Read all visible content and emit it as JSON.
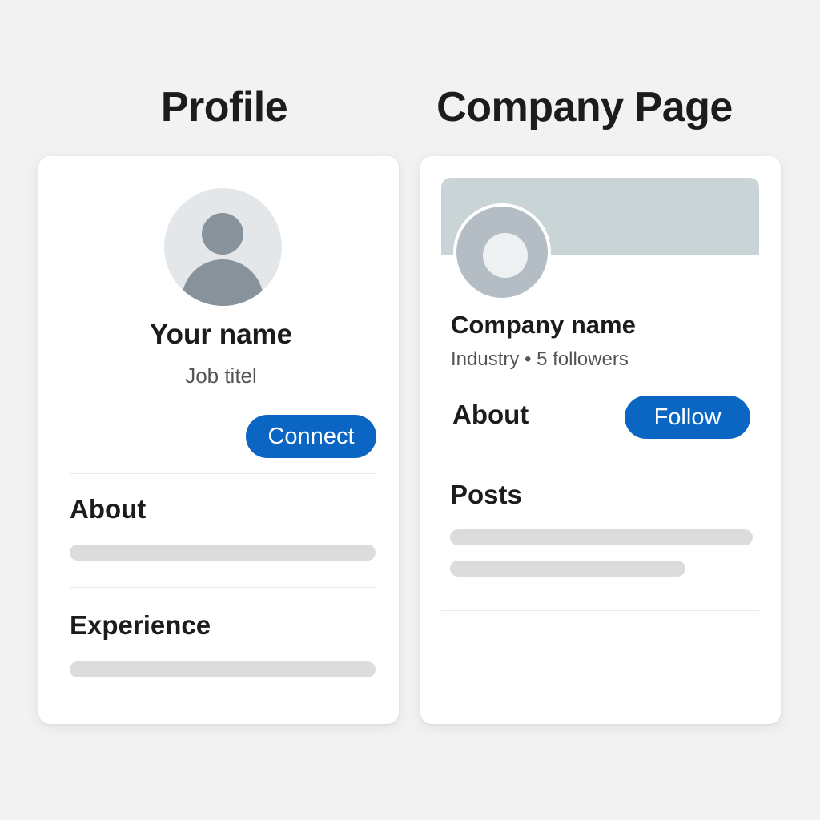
{
  "headings": {
    "profile": "Profile",
    "company": "Company Page"
  },
  "profile_card": {
    "name": "Your name",
    "job_title": "Job titel",
    "connect_label": "Connect",
    "sections": {
      "about": "About",
      "experience": "Experience"
    }
  },
  "company_card": {
    "name": "Company name",
    "meta": "Industry • 5 followers",
    "about_label": "About",
    "follow_label": "Follow",
    "posts_label": "Posts"
  },
  "colors": {
    "background": "#f2f2f2",
    "card": "#ffffff",
    "accent": "#0a66c2",
    "placeholder_bar": "#dcdcdc",
    "avatar_fg": "#87929b",
    "cover": "#c9d4d6"
  },
  "icons": {
    "profile_avatar": "person-avatar-icon",
    "company_logo": "company-logo-icon"
  }
}
